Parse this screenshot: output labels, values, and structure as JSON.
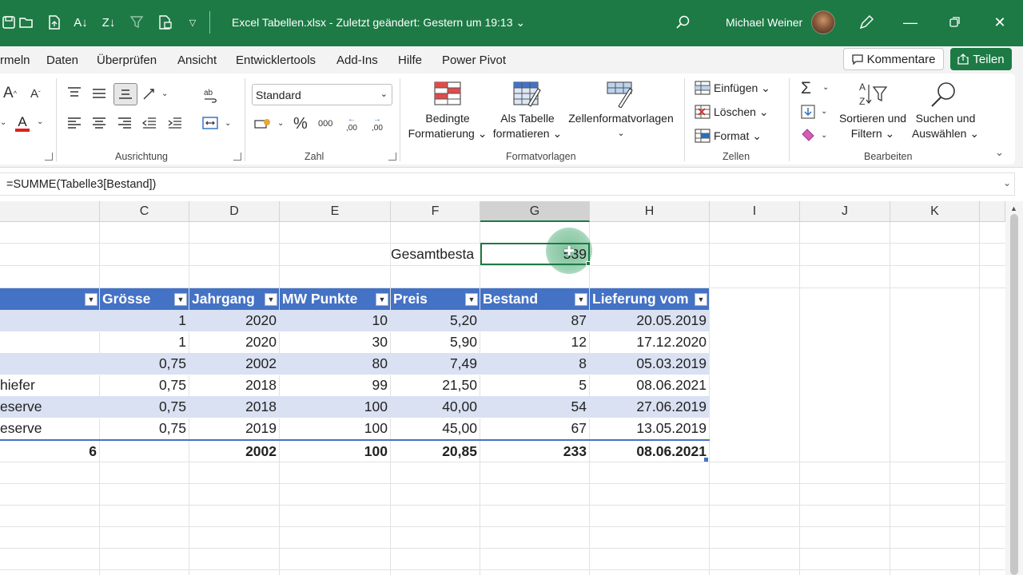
{
  "titlebar": {
    "doc_title": "Excel Tabellen.xlsx  -  Zuletzt geändert: Gestern um 19:13 ⌄",
    "user_name": "Michael Weiner",
    "icons": [
      "save-icon",
      "open-folder-icon",
      "export-icon",
      "sort-ascending-icon",
      "sort-descending-icon",
      "filter-clear-icon",
      "copy-format-icon",
      "customize-quick-access-icon",
      "search-icon",
      "pen-icon",
      "minimize-icon",
      "restore-icon",
      "close-icon"
    ]
  },
  "tabs": [
    "rmeln",
    "Daten",
    "Überprüfen",
    "Ansicht",
    "Entwicklertools",
    "Add-Ins",
    "Hilfe",
    "Power Pivot"
  ],
  "actions": {
    "comments": "Kommentare",
    "share": "Teilen"
  },
  "ribbon": {
    "groups": {
      "alignment": "Ausrichtung",
      "number": "Zahl",
      "styles": "Formatvorlagen",
      "cells": "Zellen",
      "editing": "Bearbeiten"
    },
    "number_format": "Standard",
    "styles_buttons": [
      {
        "line1": "Bedingte",
        "line2": "Formatierung ⌄"
      },
      {
        "line1": "Als Tabelle",
        "line2": "formatieren ⌄"
      },
      {
        "line1": "Zellenformatvorlagen",
        "line2": "⌄"
      }
    ],
    "cells_buttons": [
      "Einfügen ⌄",
      "Löschen ⌄",
      "Format ⌄"
    ],
    "editing_buttons": [
      {
        "line1": "Sortieren und",
        "line2": "Filtern ⌄"
      },
      {
        "line1": "Suchen und",
        "line2": "Auswählen ⌄"
      }
    ],
    "font_a_big": "A",
    "font_a_small": "A",
    "percent": "%",
    "thousands": "000",
    "dec_inc": ",00",
    "dec_dec": ",00",
    "sigma": "Σ"
  },
  "formula_bar": {
    "formula": "=SUMME(Tabelle3[Bestand])"
  },
  "columns": [
    "C",
    "D",
    "E",
    "F",
    "G",
    "H",
    "I",
    "J",
    "K"
  ],
  "selected_column": "G",
  "summary": {
    "label": "Gesamtbesta",
    "value": "539"
  },
  "table": {
    "headers": [
      "Grösse",
      "Jahrgang",
      "MW Punkte",
      "Preis",
      "Bestand",
      "Lieferung vom"
    ],
    "rows": [
      {
        "b": "",
        "c": "1",
        "d": "2020",
        "e": "10",
        "f": "5,20",
        "g": "87",
        "h": "20.05.2019"
      },
      {
        "b": "",
        "c": "1",
        "d": "2020",
        "e": "30",
        "f": "5,90",
        "g": "12",
        "h": "17.12.2020"
      },
      {
        "b": "",
        "c": "0,75",
        "d": "2002",
        "e": "80",
        "f": "7,49",
        "g": "8",
        "h": "05.03.2019"
      },
      {
        "b": "hiefer",
        "c": "0,75",
        "d": "2018",
        "e": "99",
        "f": "21,50",
        "g": "5",
        "h": "08.06.2021"
      },
      {
        "b": "eserve",
        "c": "0,75",
        "d": "2018",
        "e": "100",
        "f": "40,00",
        "g": "54",
        "h": "27.06.2019"
      },
      {
        "b": "eserve",
        "c": "0,75",
        "d": "2019",
        "e": "100",
        "f": "45,00",
        "g": "67",
        "h": "13.05.2019"
      }
    ],
    "totals": {
      "b": "6",
      "d": "2002",
      "e": "100",
      "f": "20,85",
      "g": "233",
      "h": "08.06.2021"
    }
  },
  "colors": {
    "excel_green": "#1d7a45",
    "table_header": "#4472c4",
    "band": "#d9e1f2"
  }
}
